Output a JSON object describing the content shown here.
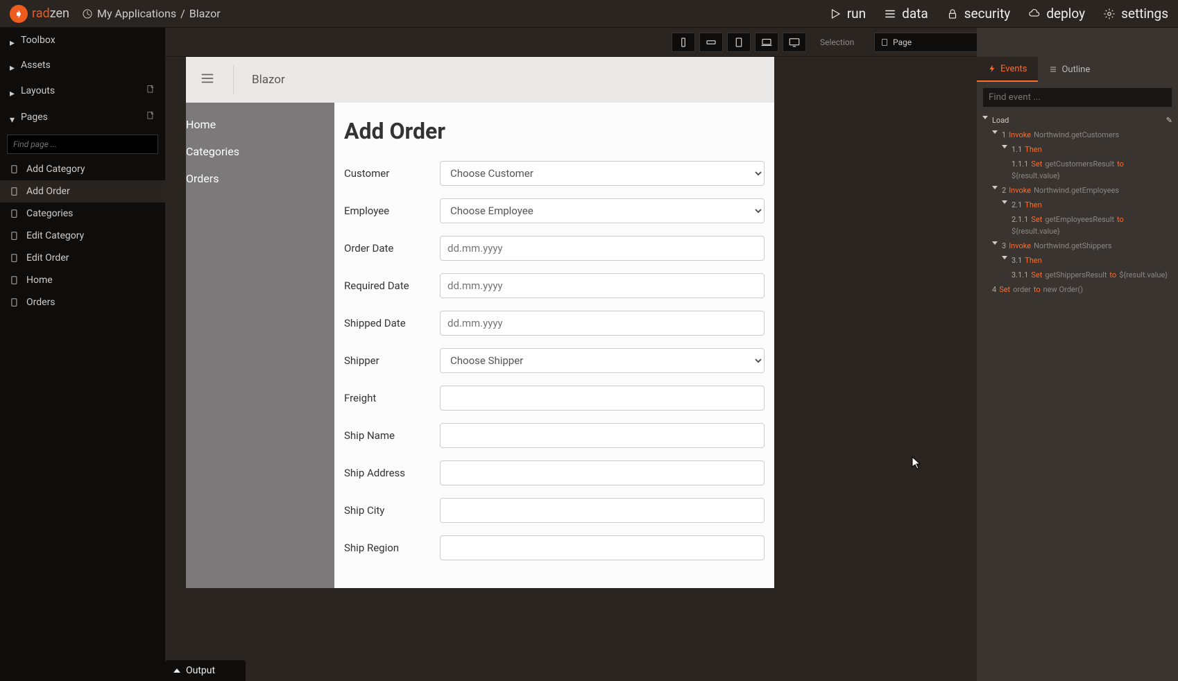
{
  "brand": {
    "rad": "rad",
    "zen": "zen"
  },
  "breadcrumb": {
    "root": "My Applications",
    "sep": "/",
    "current": "Blazor"
  },
  "header_actions": [
    "run",
    "data",
    "security",
    "deploy",
    "settings"
  ],
  "selection": {
    "label": "Selection",
    "value": "Page"
  },
  "sidebar": {
    "sections": [
      "Toolbox",
      "Assets",
      "Layouts",
      "Pages"
    ],
    "search_placeholder": "Find page ...",
    "pages": [
      "Add Category",
      "Add Order",
      "Categories",
      "Edit Category",
      "Edit Order",
      "Home",
      "Orders"
    ],
    "active_page": 1
  },
  "app": {
    "title": "Blazor",
    "nav": [
      "Home",
      "Categories",
      "Orders"
    ],
    "form_title": "Add Order",
    "fields": [
      {
        "label": "Customer",
        "type": "select",
        "placeholder": "Choose Customer"
      },
      {
        "label": "Employee",
        "type": "select",
        "placeholder": "Choose Employee"
      },
      {
        "label": "Order Date",
        "type": "date",
        "placeholder": "dd.mm.yyyy"
      },
      {
        "label": "Required Date",
        "type": "date",
        "placeholder": "dd.mm.yyyy"
      },
      {
        "label": "Shipped Date",
        "type": "date",
        "placeholder": "dd.mm.yyyy"
      },
      {
        "label": "Shipper",
        "type": "select",
        "placeholder": "Choose Shipper"
      },
      {
        "label": "Freight",
        "type": "text",
        "placeholder": ""
      },
      {
        "label": "Ship Name",
        "type": "text",
        "placeholder": ""
      },
      {
        "label": "Ship Address",
        "type": "text",
        "placeholder": ""
      },
      {
        "label": "Ship City",
        "type": "text",
        "placeholder": ""
      },
      {
        "label": "Ship Region",
        "type": "text",
        "placeholder": ""
      }
    ]
  },
  "right": {
    "tabs": [
      "Events",
      "Outline"
    ],
    "active_tab": 0,
    "search_placeholder": "Find event ...",
    "load_label": "Load",
    "events": [
      {
        "num": "1",
        "kw": "Invoke",
        "target": "Northwind.getCustomers",
        "then": {
          "num": "1.1",
          "kw": "Then",
          "set": {
            "num": "1.1.1",
            "kw": "Set",
            "var": "getCustomersResult",
            "to": "to",
            "val": "${result.value}"
          }
        }
      },
      {
        "num": "2",
        "kw": "Invoke",
        "target": "Northwind.getEmployees",
        "then": {
          "num": "2.1",
          "kw": "Then",
          "set": {
            "num": "2.1.1",
            "kw": "Set",
            "var": "getEmployeesResult",
            "to": "to",
            "val": "${result.value}"
          }
        }
      },
      {
        "num": "3",
        "kw": "Invoke",
        "target": "Northwind.getShippers",
        "then": {
          "num": "3.1",
          "kw": "Then",
          "set": {
            "num": "3.1.1",
            "kw": "Set",
            "var": "getShippersResult",
            "to": "to",
            "val": "${result.value}"
          }
        }
      },
      {
        "num": "4",
        "kw": "Set",
        "var": "order",
        "to": "to",
        "val": "new Order()"
      }
    ]
  },
  "output": {
    "label": "Output"
  }
}
